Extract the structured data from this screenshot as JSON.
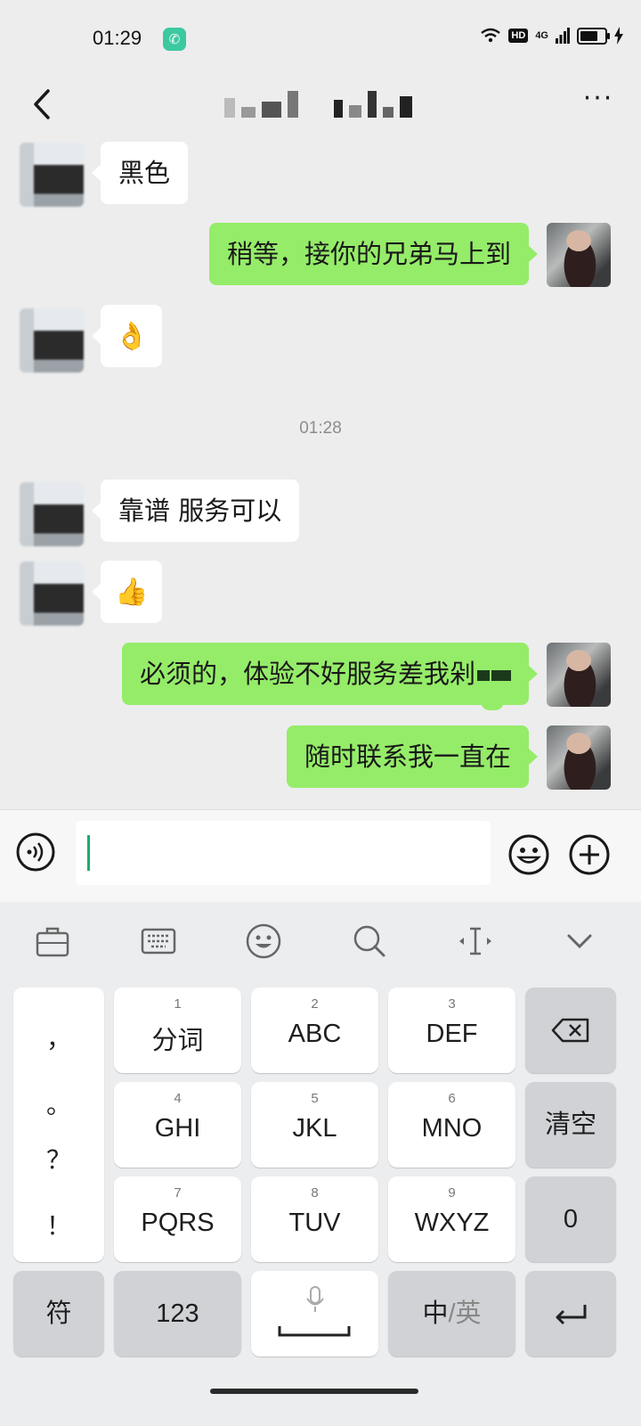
{
  "status_bar": {
    "time": "01:29",
    "network": "4G",
    "hd": "HD"
  },
  "chat": {
    "messages": [
      {
        "side": "left",
        "text": "黑色"
      },
      {
        "side": "right",
        "text": "稍等，接你的兄弟马上到"
      },
      {
        "side": "left",
        "emoji": "👌"
      },
      {
        "side": "left",
        "text": "靠谱 服务可以"
      },
      {
        "side": "left",
        "emoji": "👍"
      },
      {
        "side": "right",
        "text": "必须的，体验不好服务差我剁"
      },
      {
        "side": "right",
        "text": "随时联系我一直在"
      }
    ],
    "time_separator": "01:28"
  },
  "input": {
    "value": ""
  },
  "keyboard": {
    "punctuation": [
      "，",
      "。",
      "？",
      "！"
    ],
    "keys": [
      {
        "num": "1",
        "label": "分词"
      },
      {
        "num": "2",
        "label": "ABC"
      },
      {
        "num": "3",
        "label": "DEF"
      },
      {
        "num": "4",
        "label": "GHI"
      },
      {
        "num": "5",
        "label": "JKL"
      },
      {
        "num": "6",
        "label": "MNO"
      },
      {
        "num": "7",
        "label": "PQRS"
      },
      {
        "num": "8",
        "label": "TUV"
      },
      {
        "num": "9",
        "label": "WXYZ"
      }
    ],
    "clear_label": "清空",
    "zero_label": "0",
    "symbol_label": "符",
    "numbers_label": "123",
    "lang_primary": "中",
    "lang_sep": "/",
    "lang_secondary": "英"
  },
  "colors": {
    "sent_bubble": "#95ec69",
    "received_bubble": "#ffffff",
    "background": "#ededed",
    "caret": "#1aad6d"
  }
}
